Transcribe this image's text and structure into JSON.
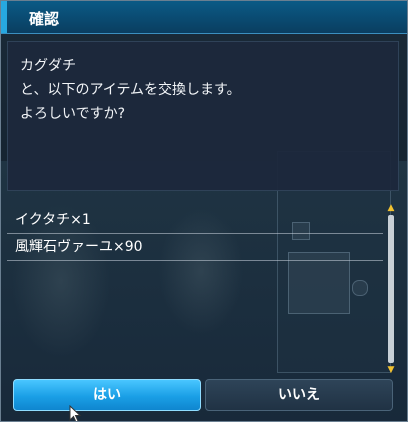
{
  "window": {
    "title": "確認"
  },
  "message": {
    "lines": [
      "カグダチ",
      "と、以下のアイテムを交換します。",
      "よろしいですか?"
    ]
  },
  "items": [
    {
      "label": "イクタチ×1"
    },
    {
      "label": "風輝石ヴァーユ×90"
    }
  ],
  "buttons": {
    "yes_label": "はい",
    "no_label": "いいえ"
  },
  "icons": {
    "scroll_up": "scroll-up-arrow-icon",
    "scroll_down": "scroll-down-arrow-icon",
    "cursor": "mouse-pointer-icon"
  },
  "colors": {
    "title_bar": "#0b5a86",
    "accent": "#27a8e0",
    "primary_button": "#1a9fe6",
    "secondary_button": "#203244",
    "scroll_arrow": "#f2c230"
  }
}
